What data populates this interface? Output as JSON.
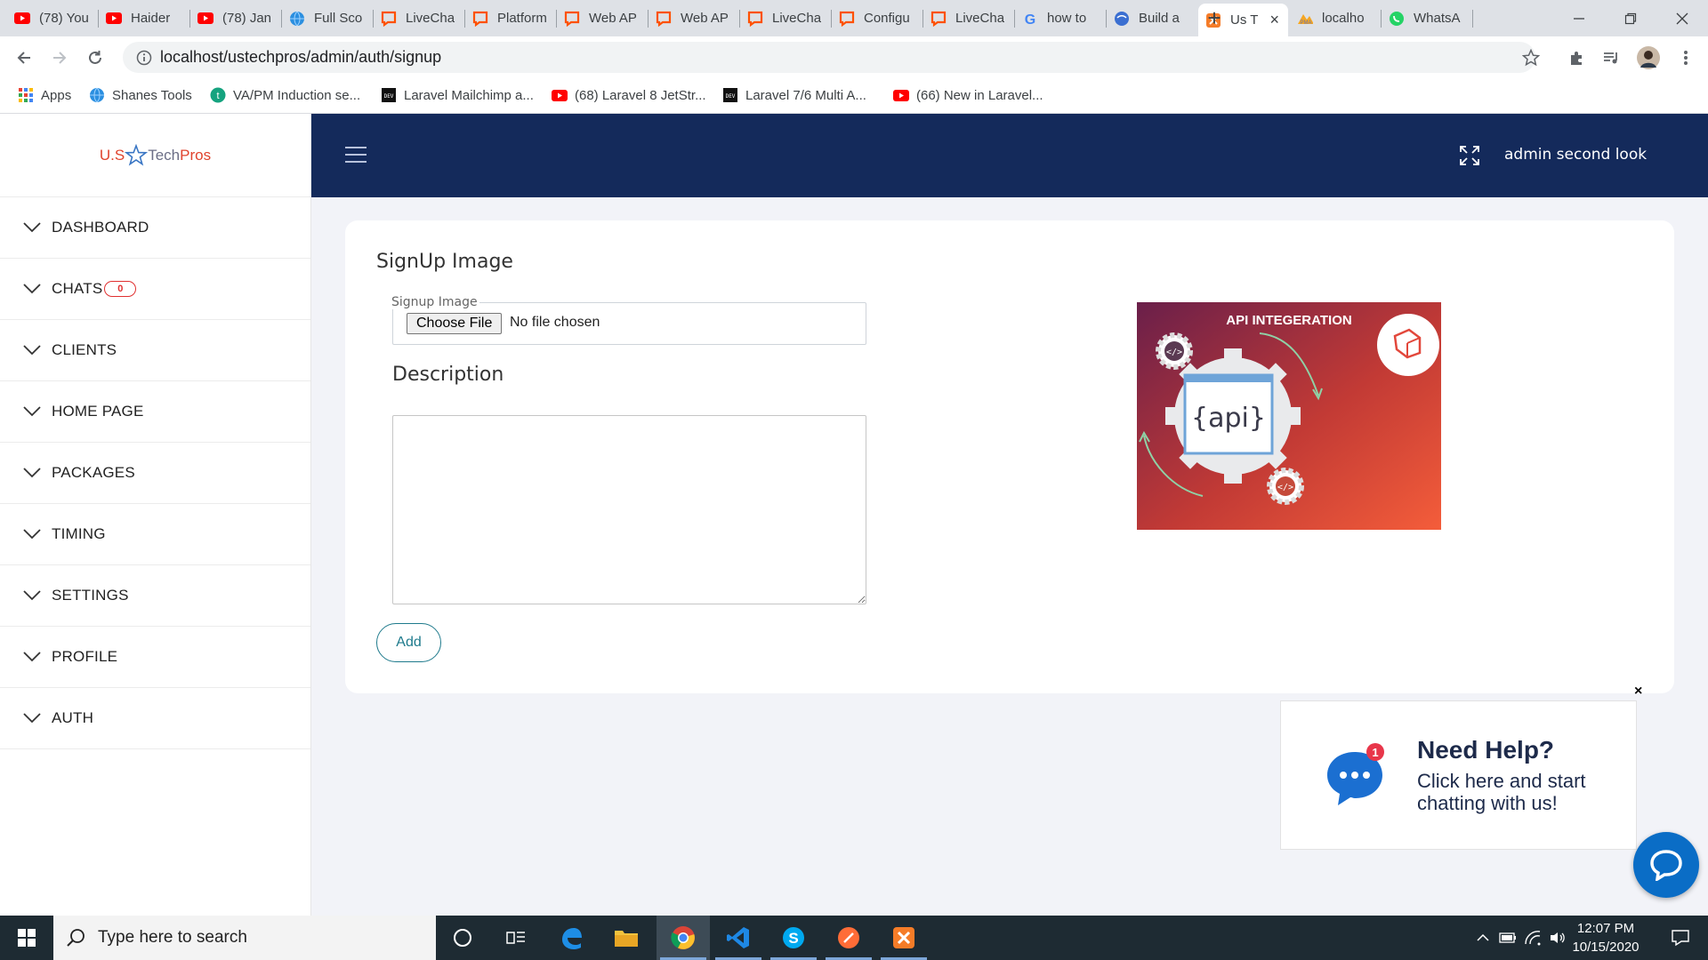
{
  "browser": {
    "tabs": [
      {
        "title": "(78) You",
        "icon": "youtube-icon"
      },
      {
        "title": "Haider",
        "icon": "youtube-icon"
      },
      {
        "title": "(78) Jan",
        "icon": "youtube-icon"
      },
      {
        "title": "Full Sco",
        "icon": "globe-icon"
      },
      {
        "title": "LiveCha",
        "icon": "livechat-icon"
      },
      {
        "title": "Platform",
        "icon": "livechat-icon"
      },
      {
        "title": "Web AP",
        "icon": "livechat-icon"
      },
      {
        "title": "Web AP",
        "icon": "livechat-icon"
      },
      {
        "title": "LiveCha",
        "icon": "livechat-icon"
      },
      {
        "title": "Configu",
        "icon": "livechat-icon"
      },
      {
        "title": "LiveCha",
        "icon": "livechat-icon"
      },
      {
        "title": "how to",
        "icon": "google-icon"
      },
      {
        "title": "Build a",
        "icon": "webapp-icon"
      },
      {
        "title": "Us T",
        "icon": "xampp-icon",
        "active": true
      },
      {
        "title": "localho",
        "icon": "phpmyadmin-icon"
      },
      {
        "title": "WhatsA",
        "icon": "whatsapp-icon"
      }
    ],
    "url": "localhost/ustechpros/admin/auth/signup",
    "bookmarks": [
      {
        "label": "Apps",
        "icon": "apps-grid-icon"
      },
      {
        "label": "Shanes Tools",
        "icon": "globe-icon"
      },
      {
        "label": "VA/PM Induction se...",
        "icon": "trello-icon"
      },
      {
        "label": "Laravel Mailchimp a...",
        "icon": "dev-icon"
      },
      {
        "label": "(68) Laravel 8 JetStr...",
        "icon": "youtube-icon"
      },
      {
        "label": "Laravel 7/6 Multi A...",
        "icon": "dev-icon"
      },
      {
        "label": "(66) New in Laravel...",
        "icon": "youtube-icon"
      }
    ]
  },
  "app": {
    "logo": {
      "us": "U.S",
      "tech": "Tech",
      "pros": "Pros"
    },
    "menu": [
      {
        "label": "DASHBOARD"
      },
      {
        "label": "CHATS",
        "badge": "0"
      },
      {
        "label": "CLIENTS"
      },
      {
        "label": "HOME PAGE"
      },
      {
        "label": "PACKAGES"
      },
      {
        "label": "TIMING"
      },
      {
        "label": "SETTINGS"
      },
      {
        "label": "PROFILE"
      },
      {
        "label": "AUTH"
      }
    ],
    "admin_name": "admin second look",
    "form": {
      "title": "SignUp Image",
      "file_label": "Signup Image",
      "choose_file": "Choose File",
      "no_file": "No file chosen",
      "description_label": "Description",
      "description_value": "",
      "add_button": "Add"
    },
    "preview": {
      "heading": "API INTEGERATION",
      "code": "{api}"
    }
  },
  "chat_widget": {
    "title": "Need Help?",
    "subtitle": "Click here and start chatting with us!",
    "notification_count": "1",
    "close": "×"
  },
  "taskbar": {
    "search_placeholder": "Type here to search",
    "time": "12:07 PM",
    "date": "10/15/2020"
  },
  "colors": {
    "nav_bg": "#142a5b",
    "accent": "#1e7a8c",
    "badge": "#e03030",
    "chat_blue": "#0a6dc6"
  }
}
